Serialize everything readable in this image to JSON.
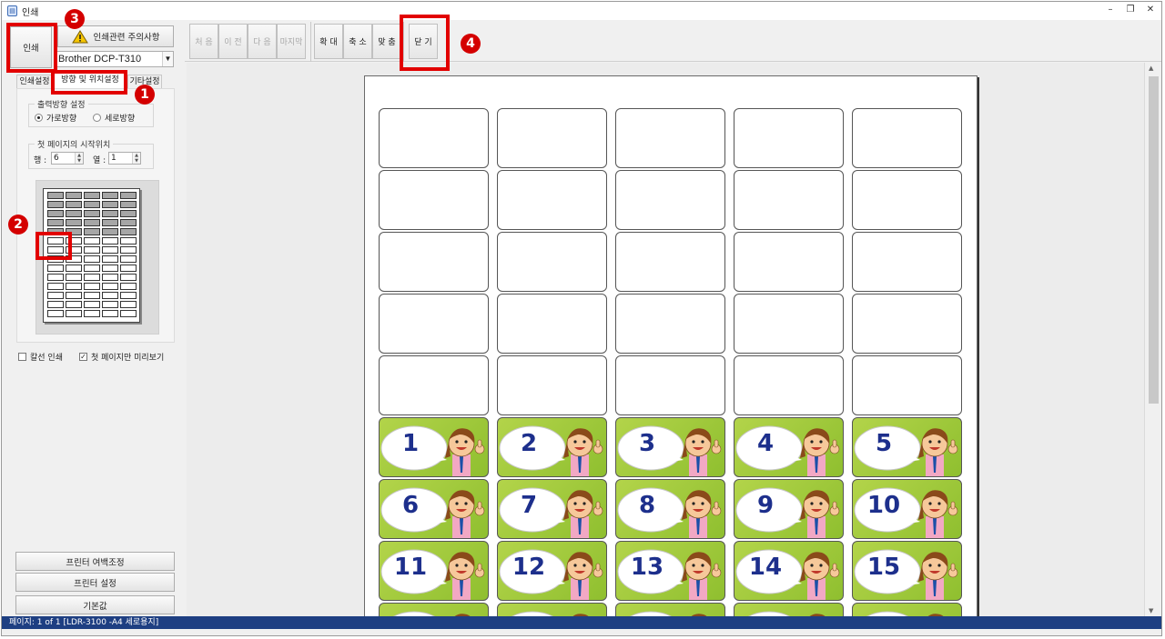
{
  "window": {
    "title": "인쇄",
    "app_icon": "document-icon",
    "controls": [
      "minimize",
      "restore",
      "close"
    ]
  },
  "left": {
    "print_button": "인쇄",
    "warning_button": "인쇄관련 주의사항",
    "printer_select": "Brother DCP-T310",
    "tabs": [
      "인쇄설정",
      "방향 및 위치설정",
      "기타설정"
    ],
    "orientation": {
      "legend": "출력방향 설정",
      "landscape": "가로방향",
      "portrait": "세로방향",
      "selected": "가로방향"
    },
    "start_position": {
      "legend": "첫 페이지의 시작위치",
      "row_label": "행 :",
      "row_value": "6",
      "col_label": "열 :",
      "col_value": "1"
    },
    "mini_layout": {
      "columns": 5,
      "rows": 14,
      "filled_rows": 5
    },
    "checkboxes": [
      {
        "label": "칼선 인쇄",
        "checked": false
      },
      {
        "label": "첫 페이지만 미리보기",
        "checked": true
      }
    ],
    "bottom_buttons": [
      "프린터 여백조정",
      "프린터 설정",
      "기본값"
    ]
  },
  "toolbar": {
    "nav": [
      "처 음",
      "이 전",
      "다 음",
      "마지막"
    ],
    "zoom": [
      "확 대",
      "축 소",
      "맞 춤"
    ],
    "close": "닫 기"
  },
  "preview": {
    "columns": 5,
    "empty_rows": 5,
    "label_numbers": [
      "1",
      "2",
      "3",
      "4",
      "5",
      "6",
      "7",
      "8",
      "9",
      "10",
      "11",
      "12",
      "13",
      "14",
      "15"
    ],
    "label_image": "cartoon-kid-thumbs-up"
  },
  "status": "페이지: 1 of 1 [LDR-3100 -A4 세로용지]",
  "annotations": [
    "1",
    "2",
    "3",
    "4"
  ],
  "colors": {
    "highlight": "#e20000",
    "status_bar": "#1e3f82",
    "label_green": "#9fc83c",
    "label_number": "#1d2f8c"
  }
}
